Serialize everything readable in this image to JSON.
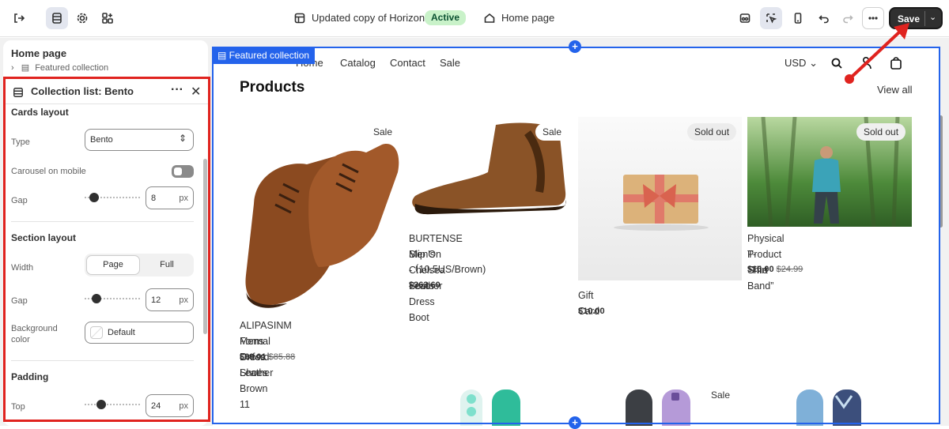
{
  "topbar": {
    "theme_title": "Updated copy of Horizon",
    "status": "Active",
    "page": "Home page",
    "save_label": "Save"
  },
  "sidebar": {
    "home_title": "Home page",
    "featured_item": "Featured collection",
    "collection_title": "Collection list: Bento",
    "cards_layout": {
      "heading": "Cards layout",
      "type_label": "Type",
      "type_value": "Bento",
      "carousel_label": "Carousel on mobile",
      "gap_label": "Gap",
      "gap_value": "8",
      "unit": "px"
    },
    "section_layout": {
      "heading": "Section layout",
      "width_label": "Width",
      "width_options": [
        "Page",
        "Full"
      ],
      "gap_label": "Gap",
      "gap_value": "12",
      "bg_label_1": "Background",
      "bg_label_2": "color",
      "bg_value": "Default"
    },
    "padding": {
      "heading": "Padding",
      "top_label": "Top",
      "top_value": "24"
    }
  },
  "preview": {
    "tag": "Featured collection",
    "nav": [
      "Home",
      "Catalog",
      "Contact",
      "Sale"
    ],
    "currency": "USD",
    "section_title": "Products",
    "view_all": "View all",
    "products": [
      {
        "name_1": "ALIPASINM Mens Oxford Leather",
        "name_2": "Formal Dress Shoes Brown 11",
        "price": "$69.01",
        "compare": "$85.88",
        "badge": "Sale"
      },
      {
        "name_1": "BURTENSE Men's Chelsea Boots",
        "name_2": "Slip On - Leather Dress Boot",
        "name_3": "（10.5US/Brown)",
        "price": "$363.60",
        "badge": "Sale"
      },
      {
        "name_1": "Gift Card",
        "price": "$10.00",
        "badge": "Sold out"
      },
      {
        "name_1": "Physical Product “The Band”",
        "name_2": "T-Shirt",
        "price": "$10.00",
        "compare": "$24.99",
        "badge": "Sold out"
      }
    ],
    "row2_badge": "Sale"
  },
  "icons": [
    "exit-icon",
    "sections-icon",
    "settings-icon",
    "apps-icon",
    "layout-icon",
    "home-icon",
    "preview-icon",
    "select-icon",
    "mobile-icon",
    "undo-icon",
    "redo-icon",
    "more-icon",
    "search-icon",
    "account-icon",
    "cart-icon"
  ],
  "colors": {
    "selection": "#2463eb",
    "annotation": "#e0231f",
    "active_badge": "#c9f2c9"
  }
}
